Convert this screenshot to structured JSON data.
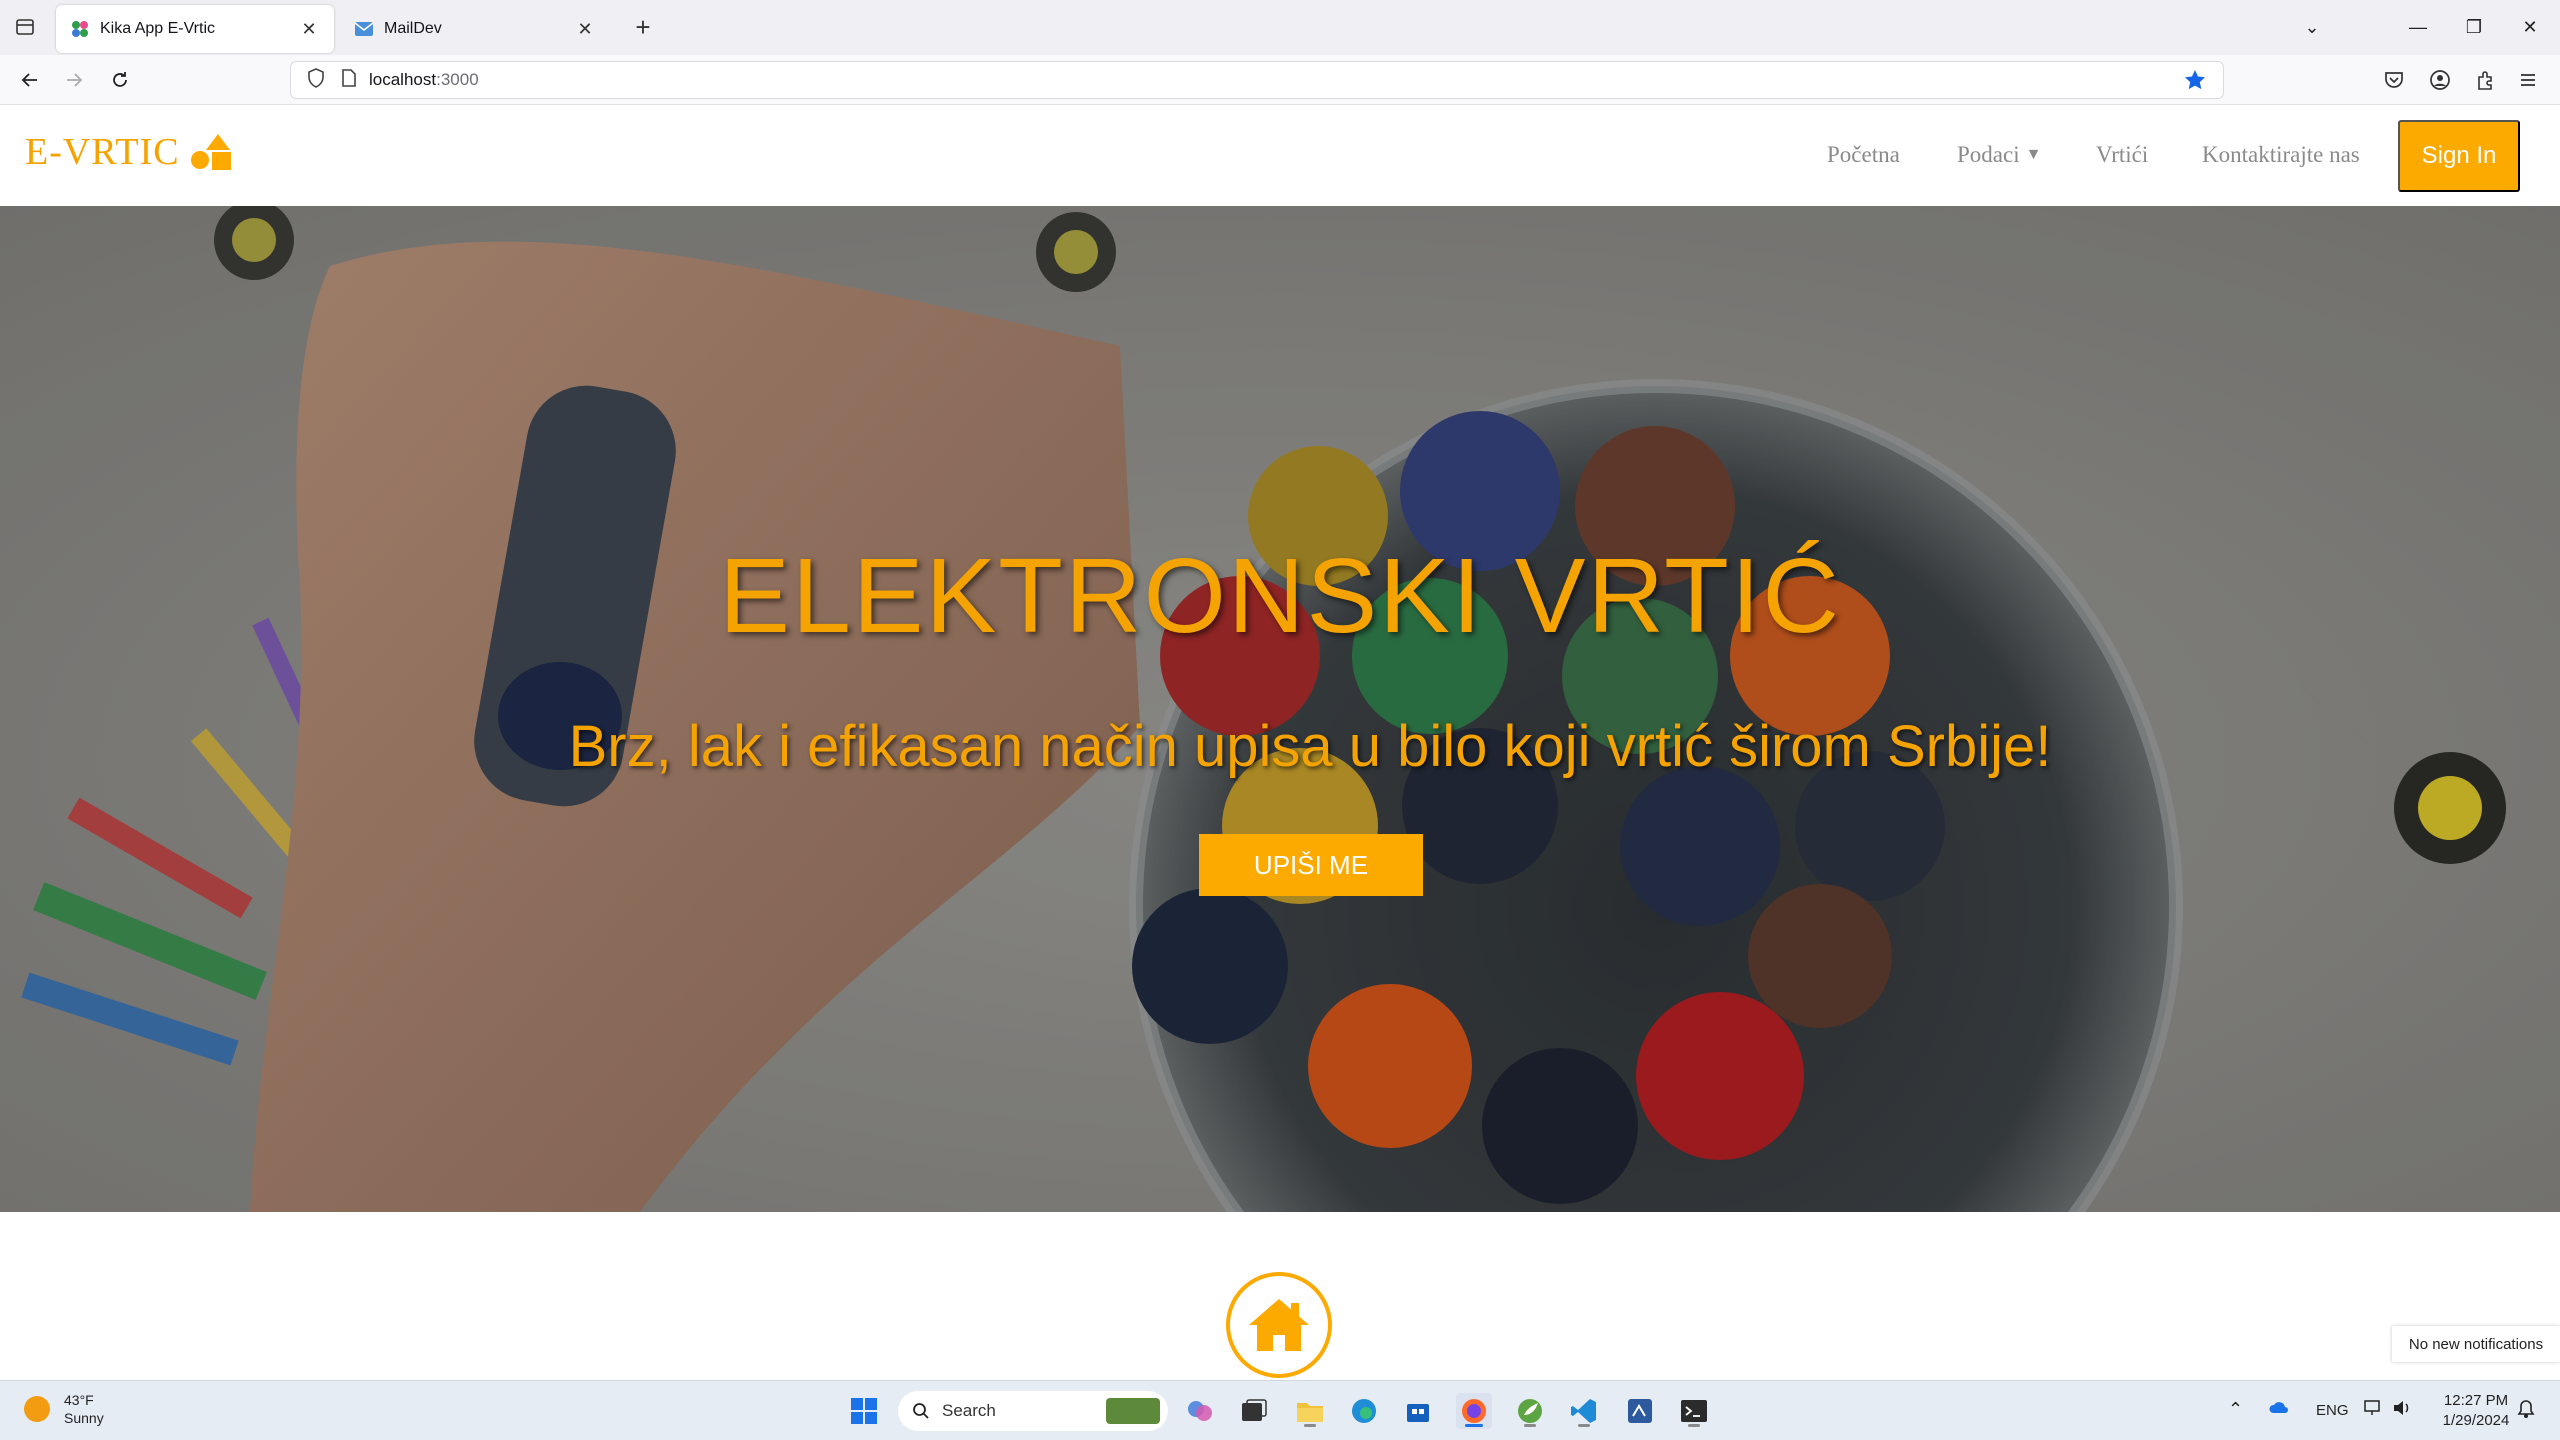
{
  "browser": {
    "tabs": [
      {
        "title": "Kika App E-Vrtic",
        "active": true
      },
      {
        "title": "MailDev",
        "active": false
      }
    ],
    "url_host": "localhost",
    "url_port": ":3000"
  },
  "site": {
    "logo_text": "E-VRTIC",
    "nav": {
      "home": "Početna",
      "data": "Podaci",
      "kindergartens": "Vrtići",
      "contact": "Kontaktirajte nas",
      "signin": "Sign In"
    },
    "hero": {
      "title": "ELEKTRONSKI VRTIĆ",
      "subtitle": "Brz, lak i efikasan način upisa u bilo koji vrtić širom Srbije!",
      "cta": "UPIŠI ME"
    },
    "accent_color": "#fca900"
  },
  "notification": {
    "text": "No new notifications"
  },
  "taskbar": {
    "weather_temp": "43°F",
    "weather_desc": "Sunny",
    "search_placeholder": "Search",
    "language": "ENG",
    "time": "12:27 PM",
    "date": "1/29/2024"
  }
}
